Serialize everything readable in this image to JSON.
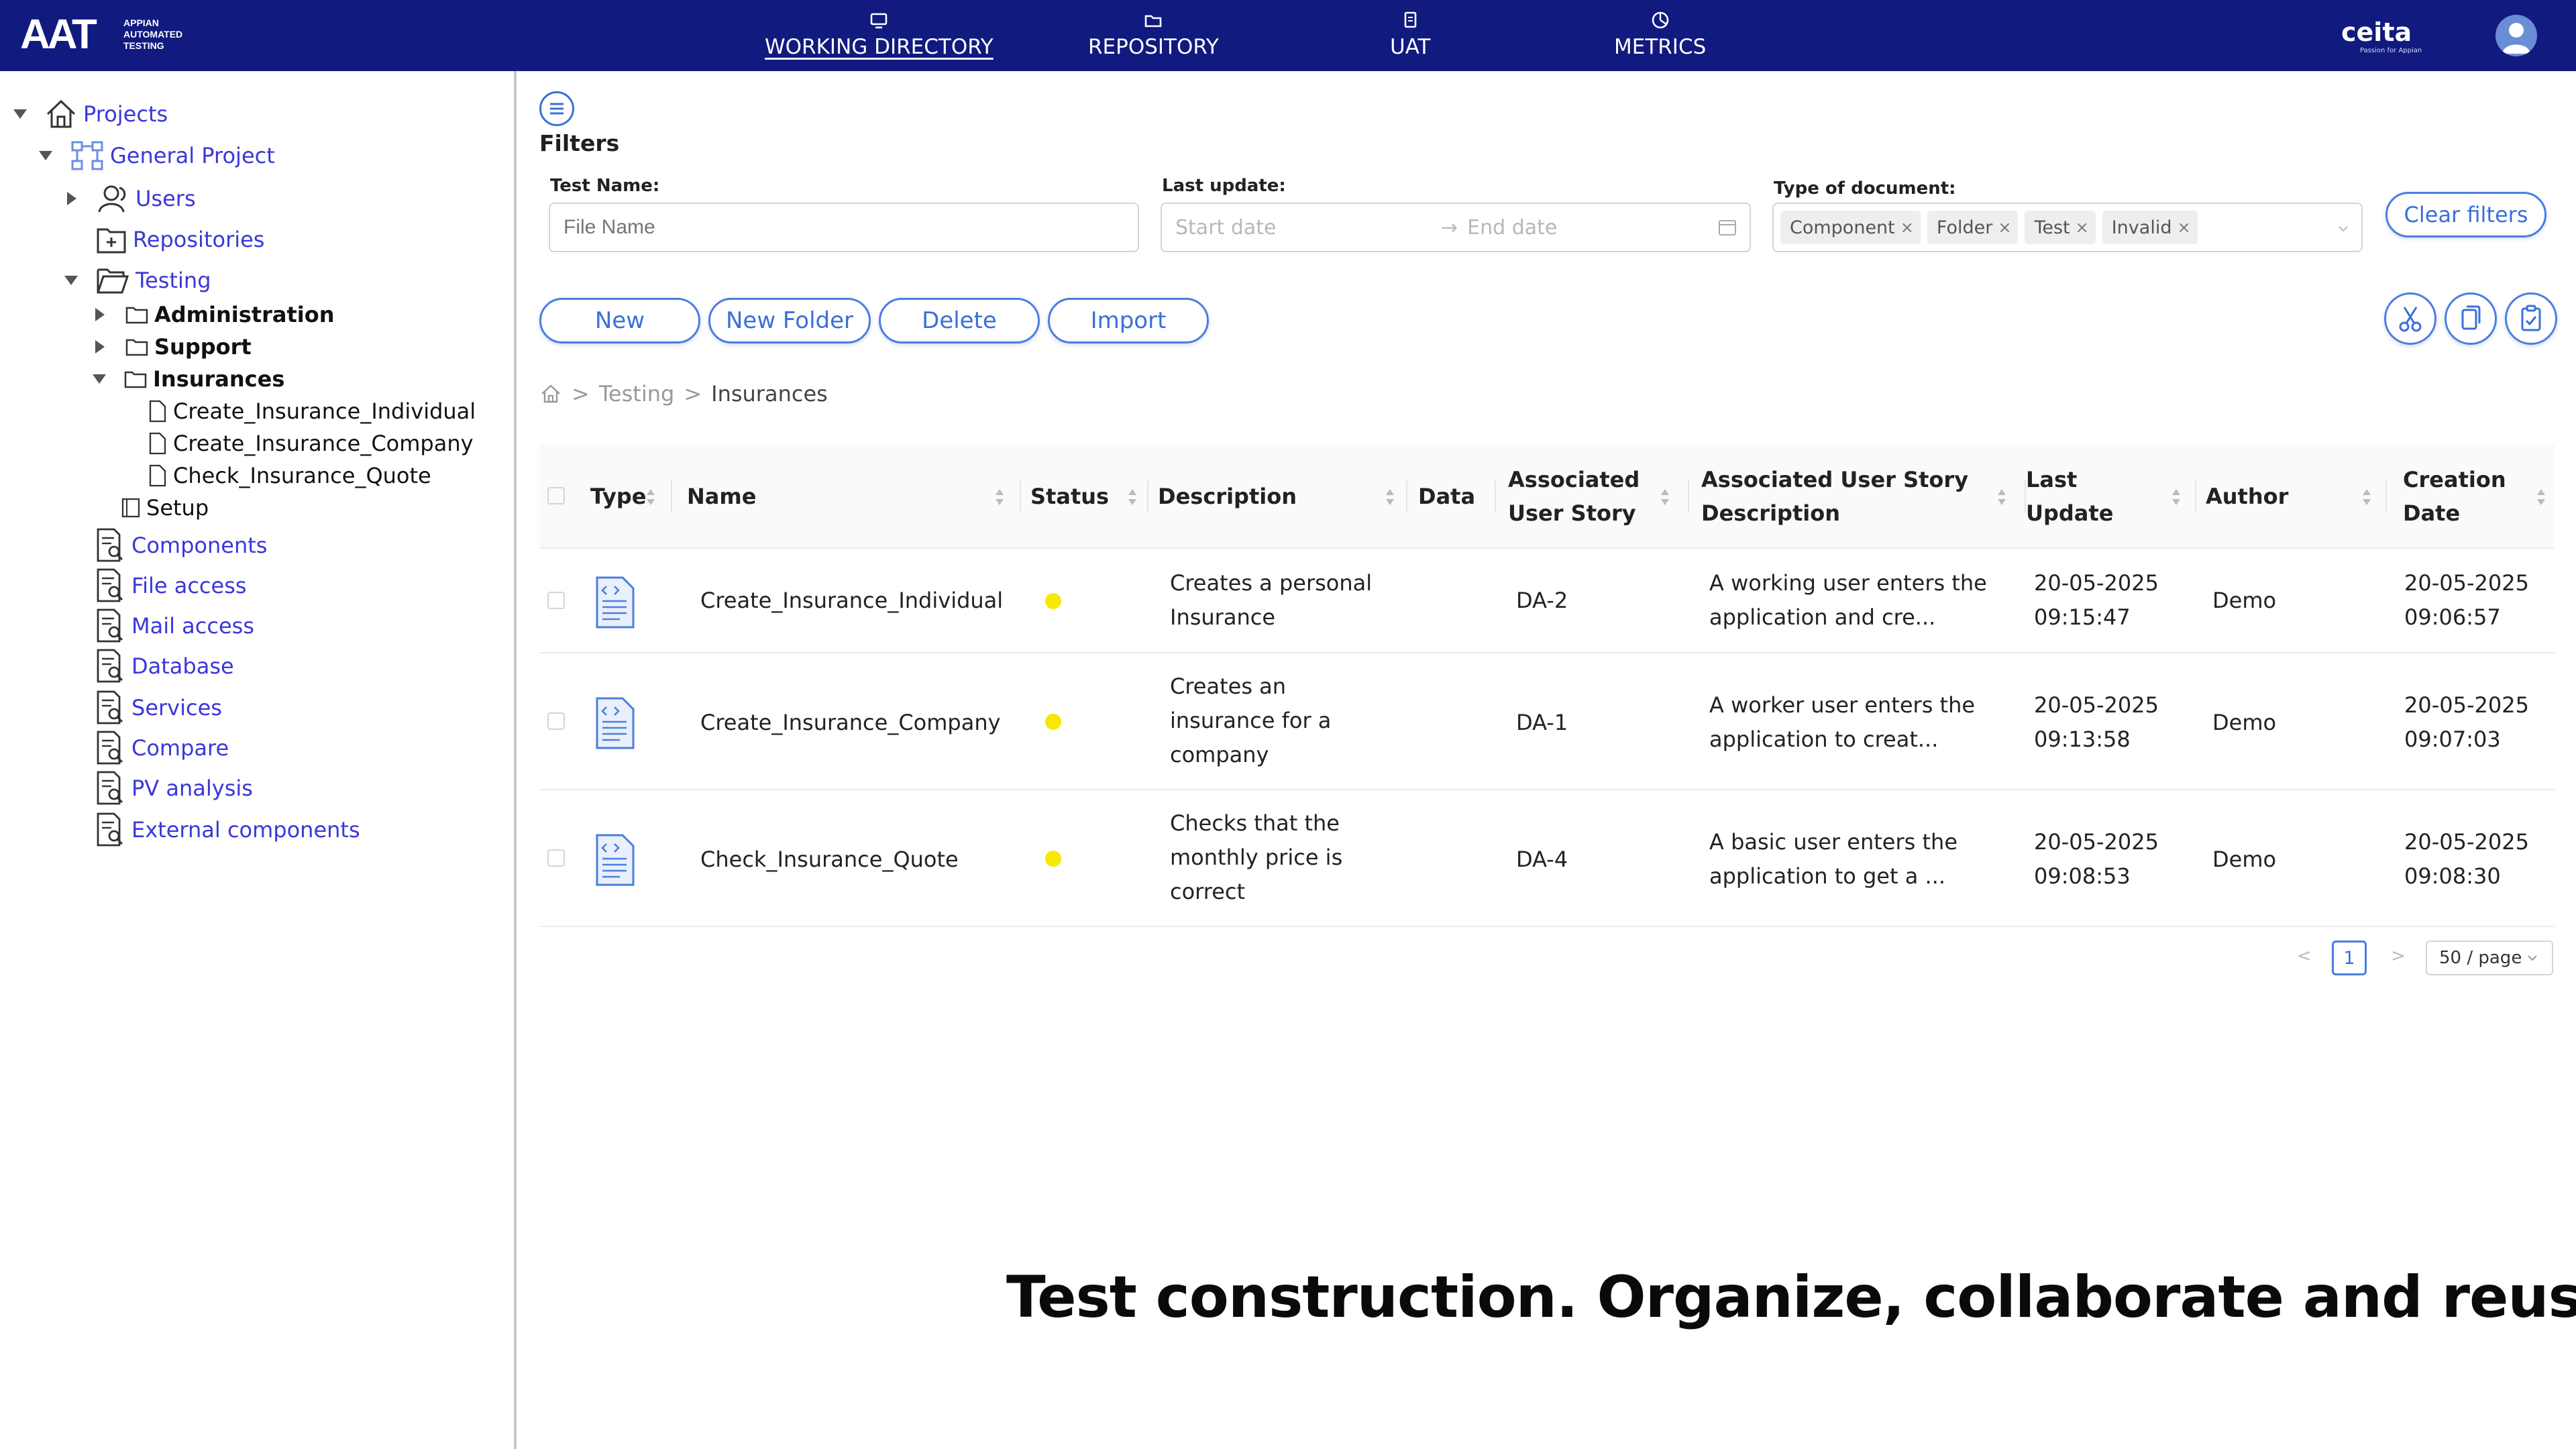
{
  "app": {
    "logo_text": "AAT",
    "logo_subtitle": "APPIAN AUTOMATED TESTING",
    "brand_name": "ceita",
    "brand_tagline": "Passion for Appian",
    "colors": {
      "topbar": "#111a7e",
      "link": "#3a37d8",
      "accent": "#4a7ee0",
      "status_yellow": "#f5e900"
    }
  },
  "nav": {
    "items": [
      {
        "label": "WORKING DIRECTORY",
        "icon": "monitor-icon",
        "active": true
      },
      {
        "label": "REPOSITORY",
        "icon": "folder-icon",
        "active": false
      },
      {
        "label": "UAT",
        "icon": "document-icon",
        "active": false
      },
      {
        "label": "METRICS",
        "icon": "pie-chart-icon",
        "active": false
      }
    ]
  },
  "sidebar": {
    "projects": "Projects",
    "general_project": "General Project",
    "users": "Users",
    "repositories": "Repositories",
    "testing": "Testing",
    "administration": "Administration",
    "support": "Support",
    "insurances": "Insurances",
    "tests": [
      "Create_Insurance_Individual",
      "Create_Insurance_Company",
      "Check_Insurance_Quote"
    ],
    "setup": "Setup",
    "tools": [
      "Components",
      "File access",
      "Mail access",
      "Database",
      "Services",
      "Compare",
      "PV analysis",
      "External components"
    ]
  },
  "filters": {
    "title": "Filters",
    "test_name_label": "Test Name:",
    "test_name_placeholder": "File Name",
    "last_update_label": "Last update:",
    "start_placeholder": "Start date",
    "end_placeholder": "End date",
    "type_label": "Type of document:",
    "type_tags": [
      "Component",
      "Folder",
      "Test",
      "Invalid"
    ],
    "tag_remove": "×",
    "clear_label": "Clear filters"
  },
  "actions": {
    "new": "New",
    "new_folder": "New Folder",
    "delete": "Delete",
    "import": "Import",
    "tools": [
      "scissors-icon",
      "copy-icon",
      "paste-icon"
    ]
  },
  "breadcrumb": {
    "sep": ">",
    "items": [
      "Testing",
      "Insurances"
    ]
  },
  "table": {
    "headers": {
      "type": "Type",
      "name": "Name",
      "status": "Status",
      "description": "Description",
      "data": "Data",
      "story_1": "Associated",
      "story_2": "User Story",
      "story_desc_1": "Associated User Story",
      "story_desc_2": "Description",
      "update_1": "Last",
      "update_2": "Update",
      "author": "Author",
      "created_1": "Creation",
      "created_2": "Date"
    },
    "rows": [
      {
        "name": "Create_Insurance_Individual",
        "status": "yellow",
        "description": [
          "Creates a personal",
          "Insurance"
        ],
        "story": "DA-2",
        "story_desc": [
          "A working user enters the",
          "application and cre..."
        ],
        "updated": [
          "20-05-2025",
          "09:15:47"
        ],
        "author": "Demo",
        "created": [
          "20-05-2025",
          "09:06:57"
        ]
      },
      {
        "name": "Create_Insurance_Company",
        "status": "yellow",
        "description": [
          "Creates an",
          "insurance for a",
          "company"
        ],
        "story": "DA-1",
        "story_desc": [
          "A worker user enters the",
          "application to creat..."
        ],
        "updated": [
          "20-05-2025",
          "09:13:58"
        ],
        "author": "Demo",
        "created": [
          "20-05-2025",
          "09:07:03"
        ]
      },
      {
        "name": "Check_Insurance_Quote",
        "status": "yellow",
        "description": [
          "Checks that the",
          "monthly price is",
          "correct"
        ],
        "story": "DA-4",
        "story_desc": [
          "A basic user enters the",
          "application to get a ..."
        ],
        "updated": [
          "20-05-2025",
          "09:08:53"
        ],
        "author": "Demo",
        "created": [
          "20-05-2025",
          "09:08:30"
        ]
      }
    ]
  },
  "pagination": {
    "prev": "<",
    "page": "1",
    "next": ">",
    "page_size": "50 / page"
  },
  "caption": "Test construction. Organize, collaborate and reuse"
}
